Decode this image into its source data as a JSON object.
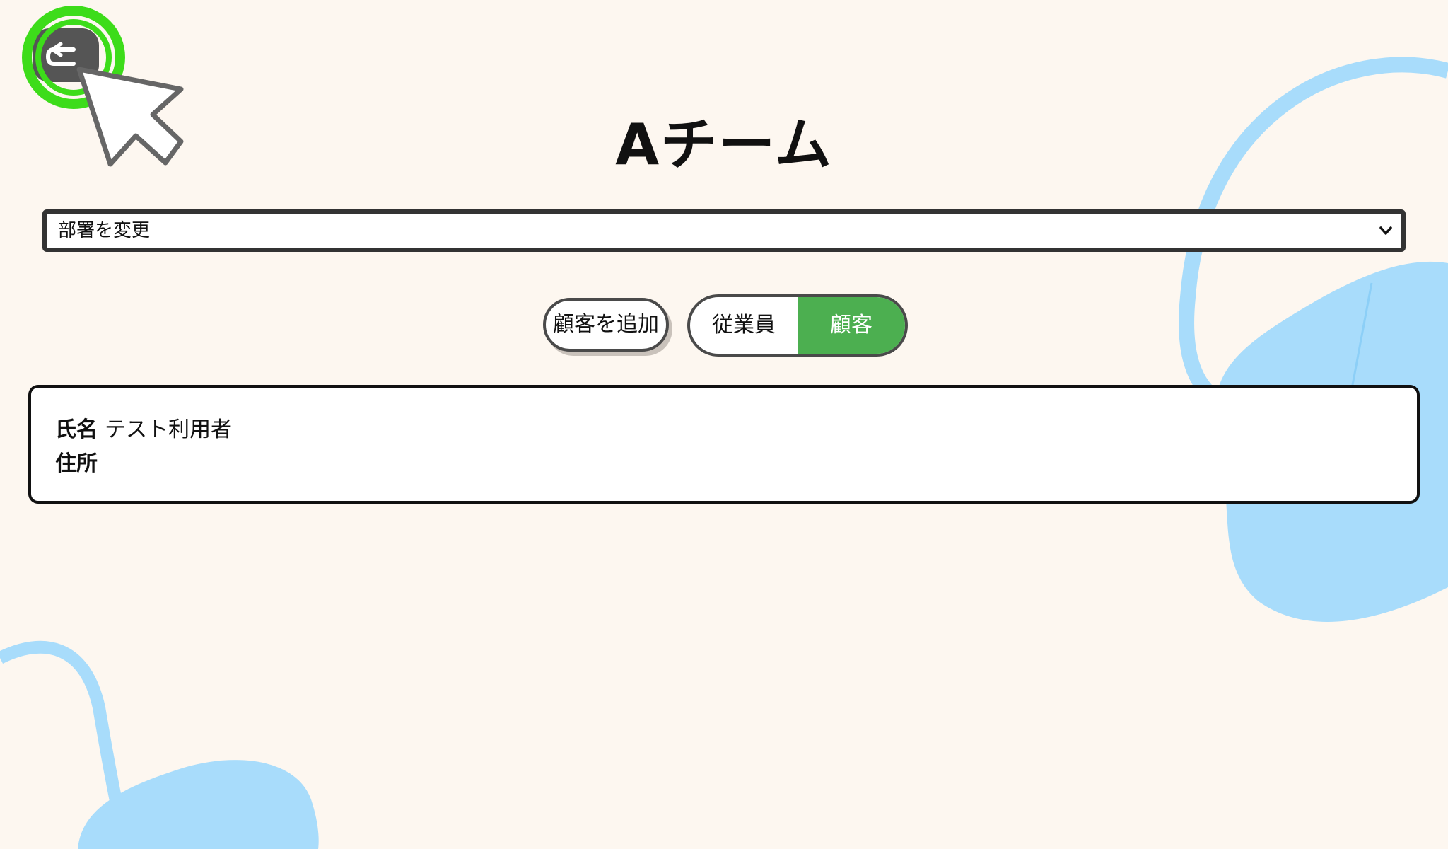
{
  "header": {
    "title": "Aチーム",
    "back_icon": "back-arrow-icon"
  },
  "department_select": {
    "selected": "部署を変更",
    "icon": "chevron-down-icon"
  },
  "actions": {
    "add_customer_label": "顧客を追加"
  },
  "view_toggle": {
    "options": [
      {
        "label": "従業員",
        "active": false
      },
      {
        "label": "顧客",
        "active": true
      }
    ],
    "active_color": "#4caf50"
  },
  "customer_card": {
    "name_label": "氏名",
    "name_value": "テスト利用者",
    "address_label": "住所",
    "address_value": ""
  },
  "colors": {
    "background": "#fdf7f0",
    "decor_blue": "#a8dcfb",
    "click_highlight": "#3ddc1a"
  }
}
